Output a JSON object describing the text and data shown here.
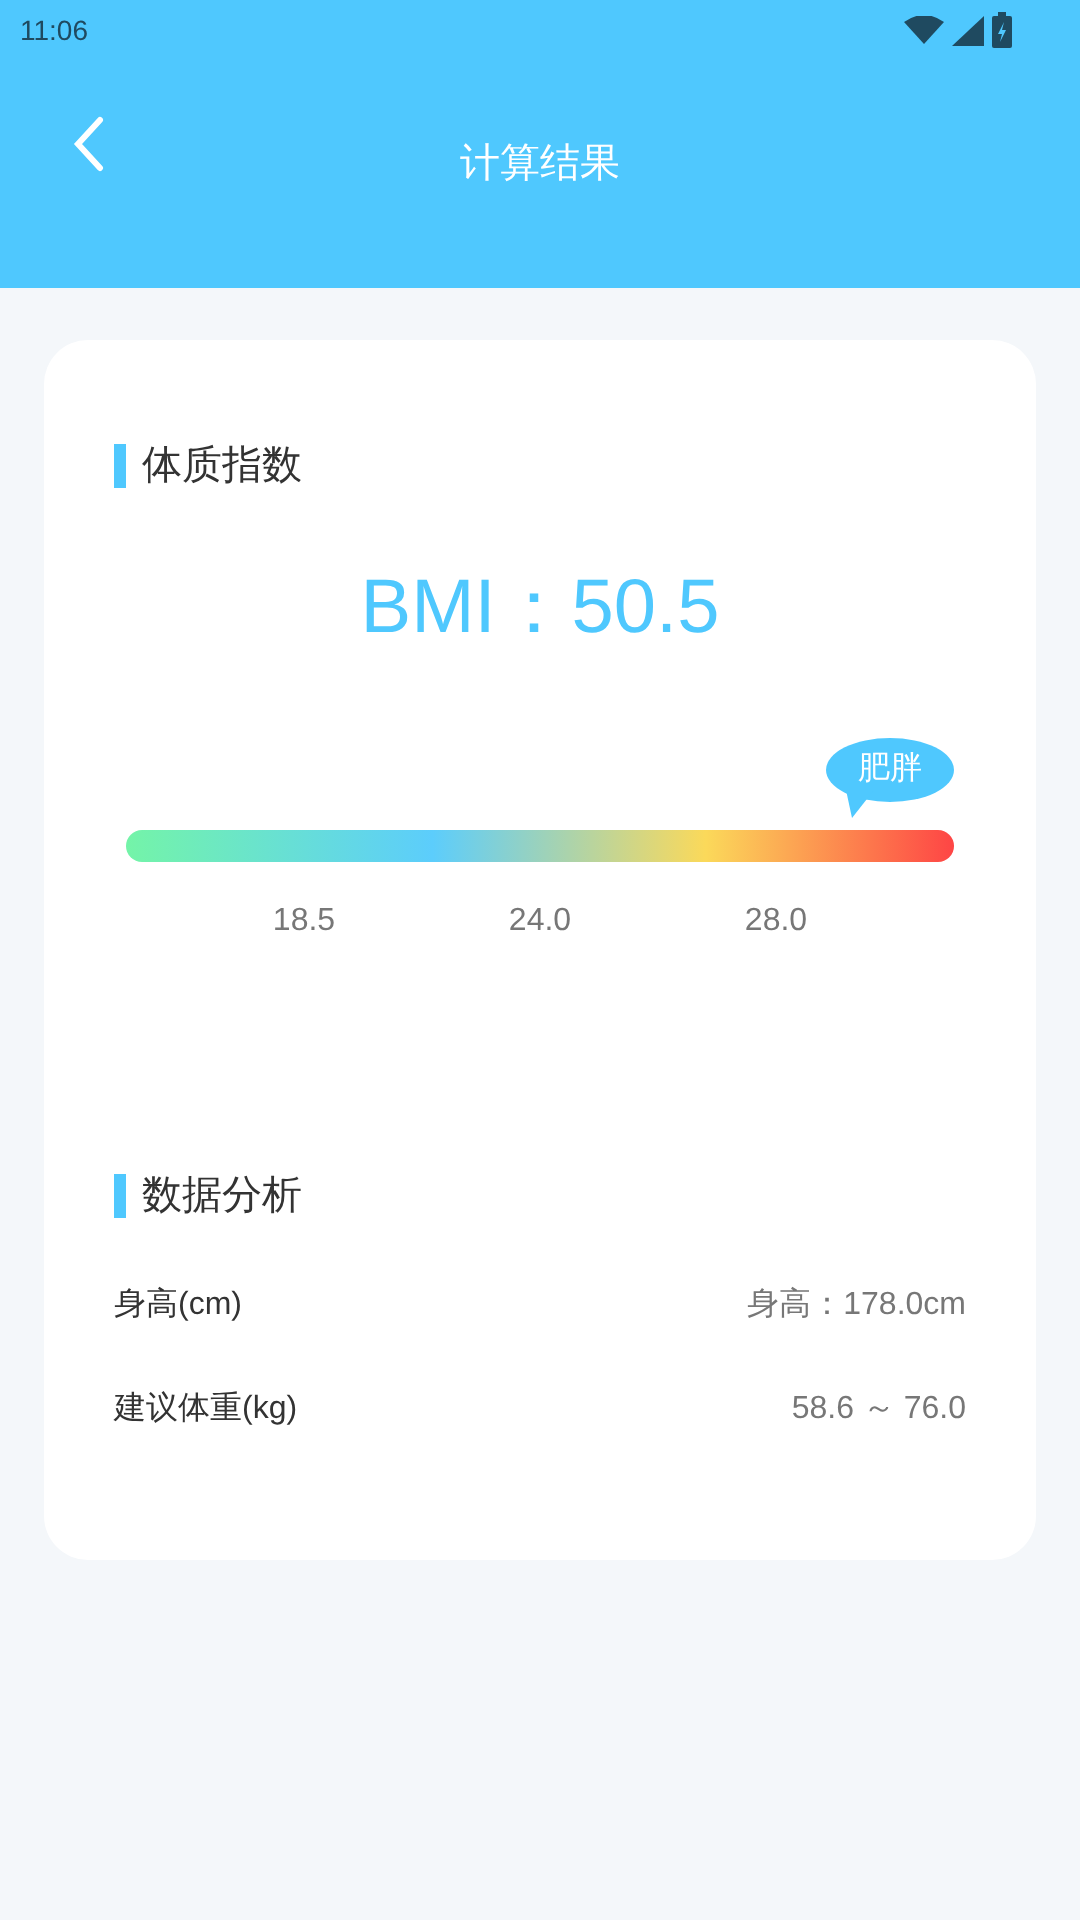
{
  "status_bar": {
    "time": "11:06"
  },
  "header": {
    "title": "计算结果"
  },
  "bmi_section": {
    "title": "体质指数",
    "value": "BMI：50.5",
    "category": "肥胖",
    "ticks": [
      "18.5",
      "24.0",
      "28.0"
    ]
  },
  "analysis": {
    "title": "数据分析",
    "rows": [
      {
        "label": "身高(cm)",
        "value": "身高：178.0cm"
      },
      {
        "label": "建议体重(kg)",
        "value": "58.6 ～ 76.0"
      }
    ]
  }
}
